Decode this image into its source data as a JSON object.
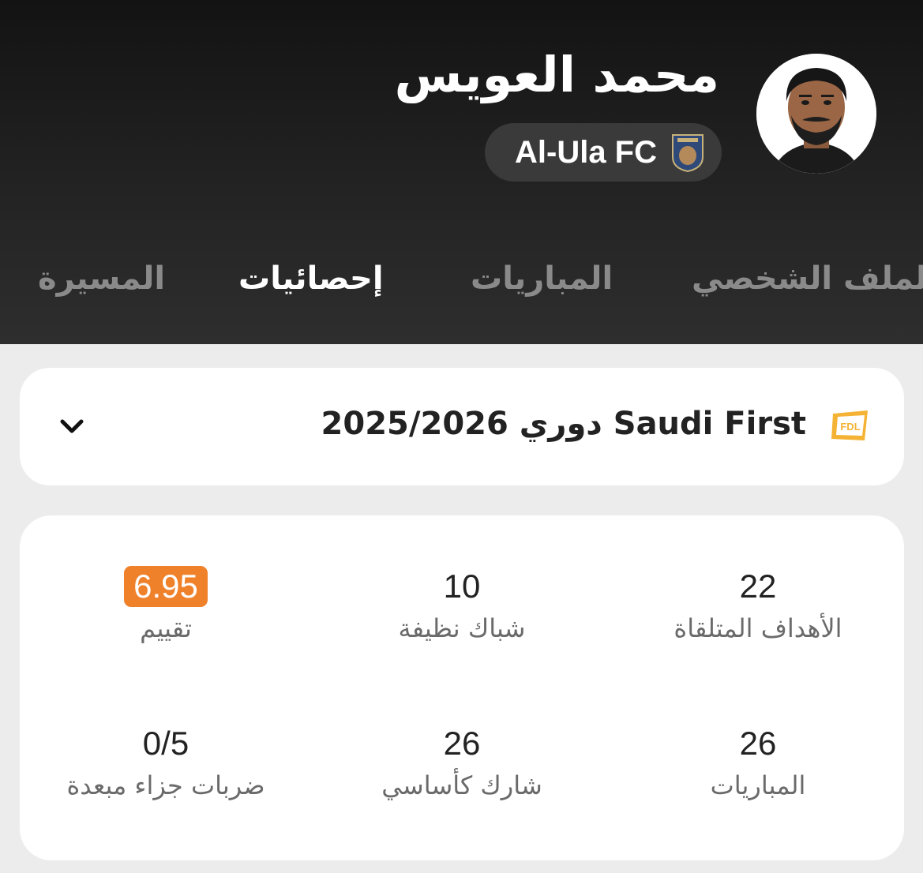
{
  "player": {
    "name": "محمد العويس",
    "team": "Al-Ula FC"
  },
  "tabs": [
    {
      "label": "الملف الشخصي",
      "active": false
    },
    {
      "label": "المباريات",
      "active": false
    },
    {
      "label": "إحصائيات",
      "active": true
    },
    {
      "label": "المسيرة",
      "active": false
    }
  ],
  "league": {
    "season_title": "2025/2026 دوري Saudi First",
    "logo_text": "FDL"
  },
  "stats": [
    {
      "value": "22",
      "label": "الأهداف المتلقاة"
    },
    {
      "value": "10",
      "label": "شباك نظيفة"
    },
    {
      "value": "6.95",
      "label": "تقييم",
      "highlight": true
    },
    {
      "value": "26",
      "label": "المباريات"
    },
    {
      "value": "26",
      "label": "شارك كأساسي"
    },
    {
      "value": "0/5",
      "label": "ضربات جزاء مبعدة"
    }
  ],
  "colors": {
    "header_top": "#131313",
    "header_bottom": "#2e2e2e",
    "page_bg": "#ececec",
    "rating_badge": "#f0812b",
    "league_logo": "#f5b335"
  },
  "icons": {
    "avatar": "player-photo",
    "team": "team-crest",
    "league": "league-logo",
    "chevron": "chevron-down-icon"
  }
}
